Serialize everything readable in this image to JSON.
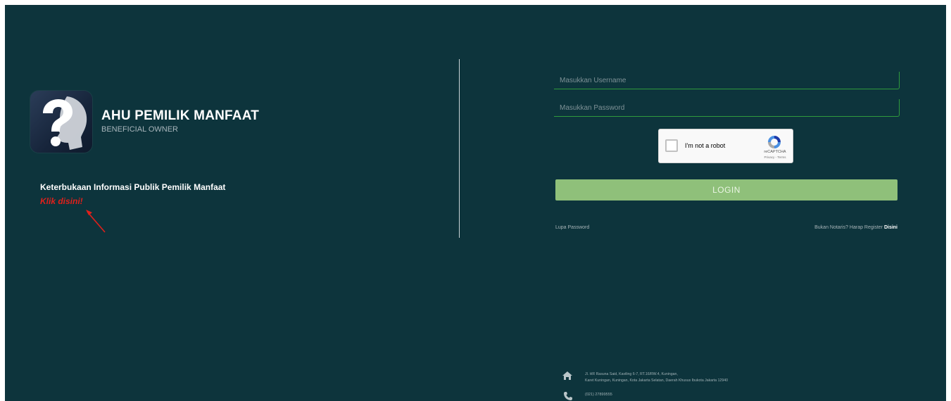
{
  "brand": {
    "title": "AHU PEMILIK MANFAAT",
    "subtitle": "BENEFICIAL OWNER",
    "logo_icon": "question-head-icon"
  },
  "public_info": {
    "title": "Keterbukaan Informasi Publik Pemilik Manfaat",
    "link_label": "Klik disini!"
  },
  "login": {
    "username_placeholder": "Masukkan Username",
    "password_placeholder": "Masukkan Password",
    "recaptcha": {
      "label": "I'm not a robot",
      "brand": "reCAPTCHA",
      "terms": "Privacy - Terms"
    },
    "button_label": "LOGIN",
    "forgot_label": "Lupa Password",
    "register_prefix": "Bukan Notaris? Harap Register ",
    "register_link": "Disini"
  },
  "footer": {
    "address_line1": "Jl. HR Rasuna Said, Kaviling 6-7, RT.16/RW.4, Kuningan,",
    "address_line2": "Karet Kuningan, Kuningan, Kota Jakarta Selatan, Daerah Khusus Ibukota Jakarta 12940",
    "phone": "(021) 27899555"
  },
  "colors": {
    "background": "#0d343c",
    "accent_green": "#8fc07a",
    "annotation_red": "#e0201b"
  }
}
